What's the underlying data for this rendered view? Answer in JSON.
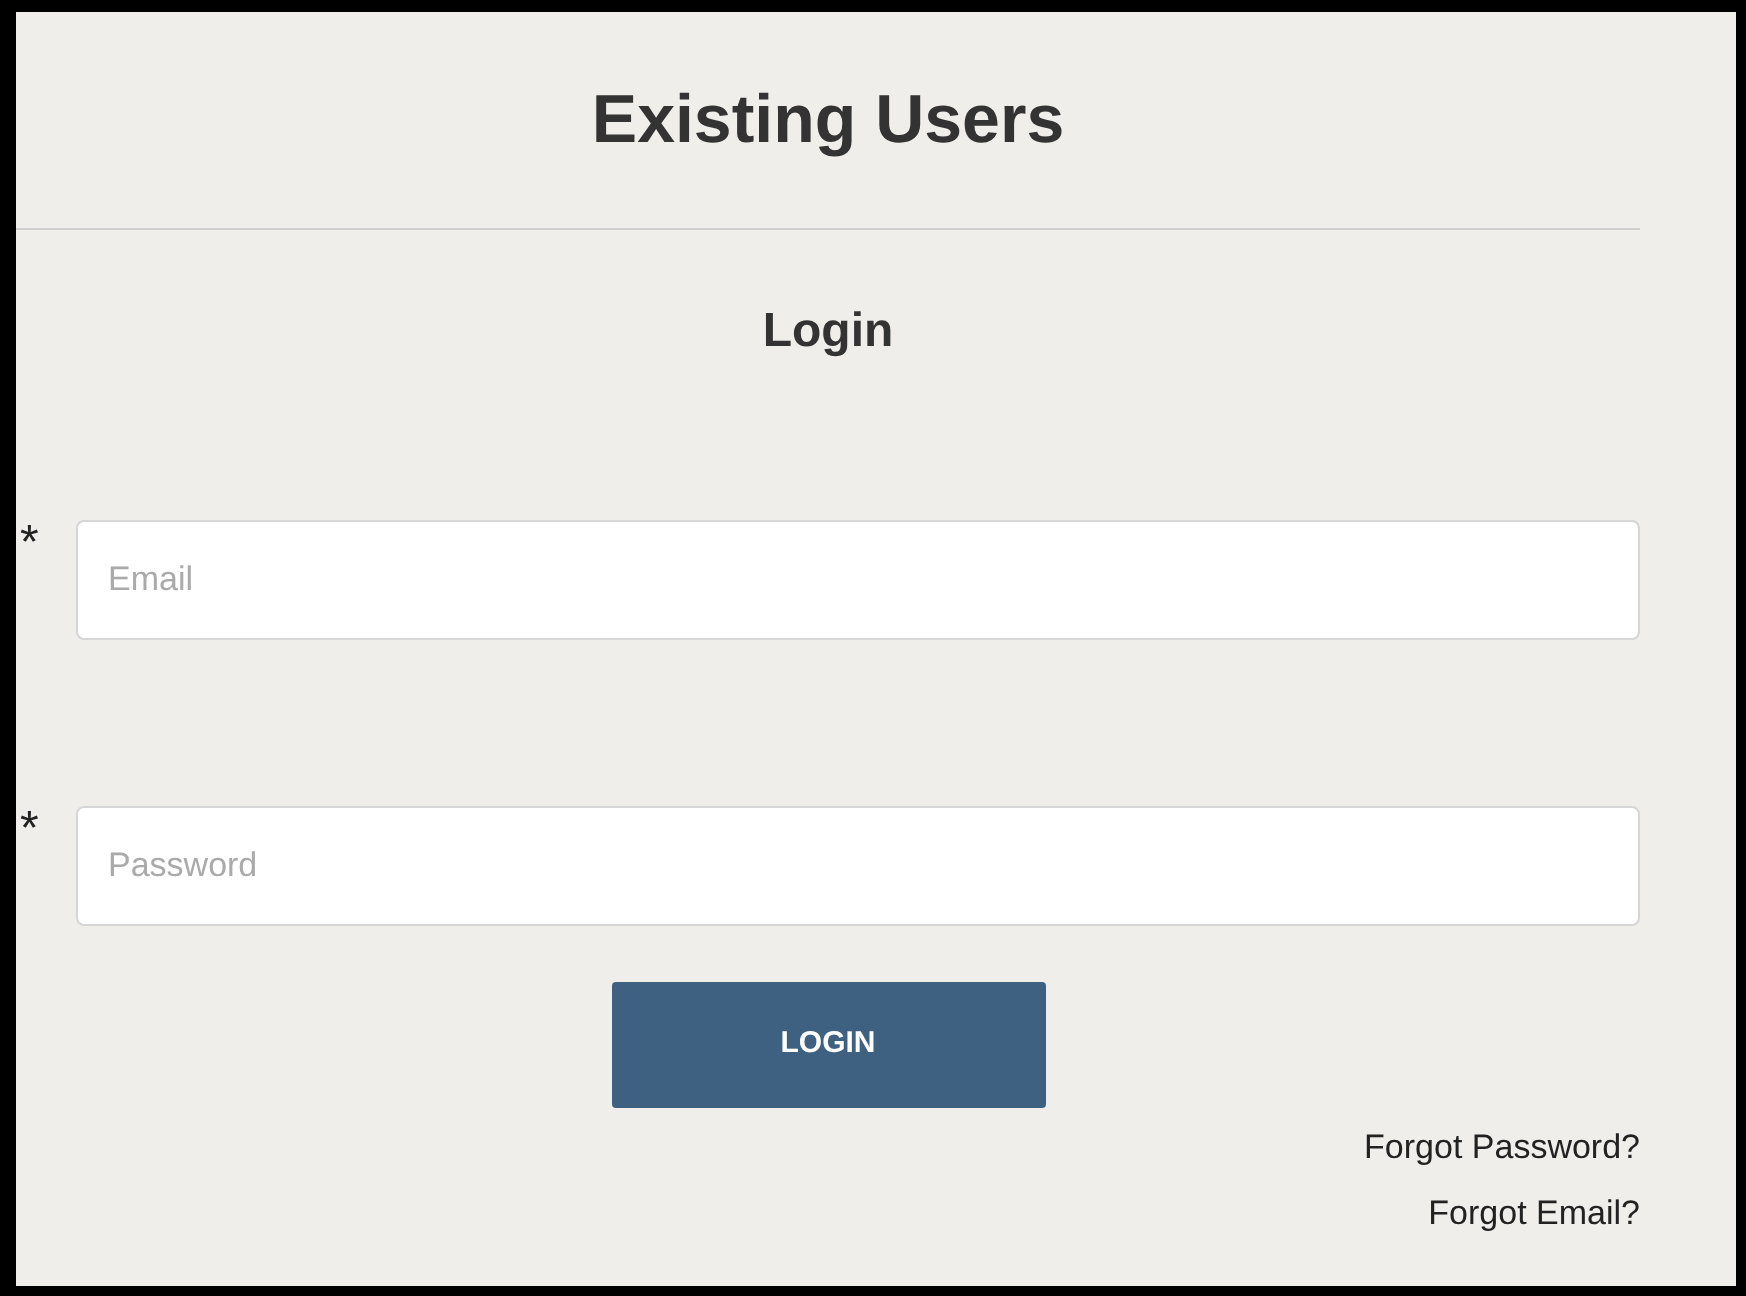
{
  "title": "Existing Users",
  "form": {
    "heading": "Login",
    "fields": [
      {
        "required_mark": "*",
        "placeholder": "Email"
      },
      {
        "required_mark": "*",
        "placeholder": "Password"
      }
    ],
    "submit": "LOGIN",
    "links": [
      "Forgot Password?",
      "Forgot Email?"
    ]
  }
}
